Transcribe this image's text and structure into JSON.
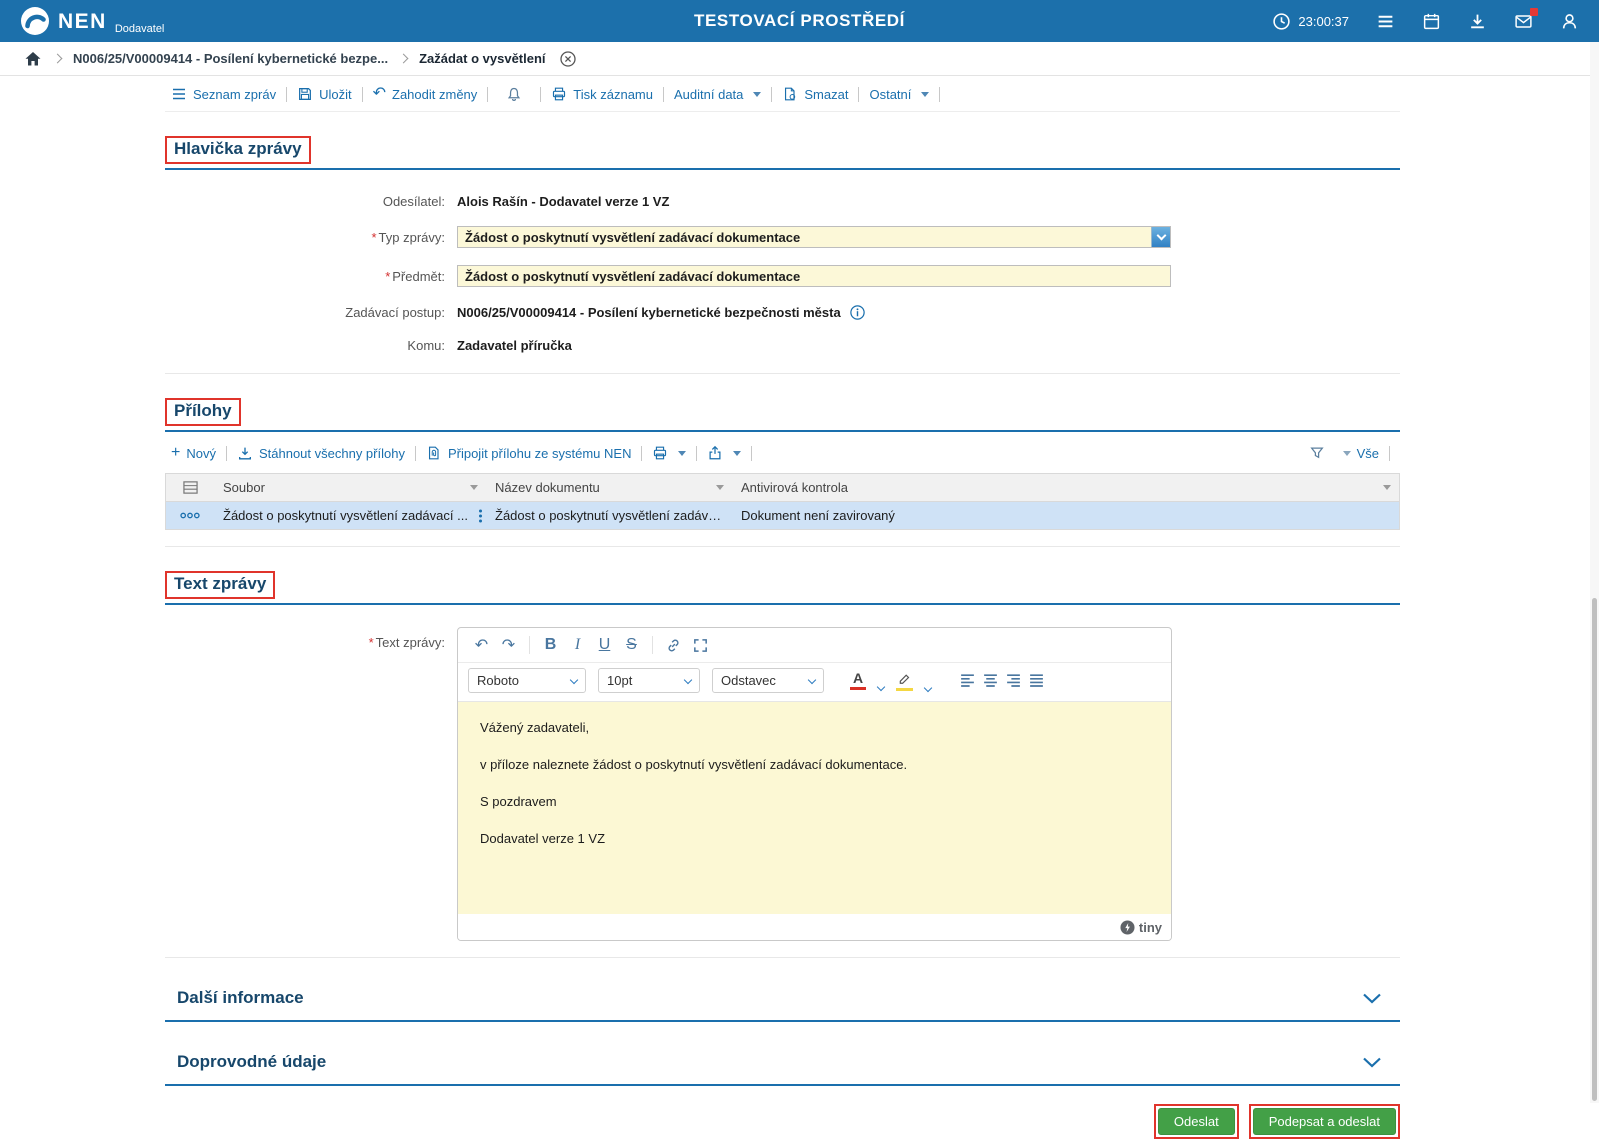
{
  "colors": {
    "header_blue": "#1c70ab",
    "link_blue": "#1a6fad",
    "section_title_blue": "#17476b",
    "field_yellow": "#fcf8d8",
    "selected_row_blue": "#cfe2f6",
    "button_green": "#43a047",
    "annotation_red": "#e0342b"
  },
  "topbar": {
    "brand": "NEN",
    "brand_sub": "Dodavatel",
    "title": "TESTOVACÍ PROSTŘEDÍ",
    "time": "23:00:37"
  },
  "breadcrumb": {
    "procedure": "N006/25/V00009414 - Posílení kybernetické bezpe...",
    "current": "Zažádat o vysvětlení"
  },
  "toolbar": {
    "seznam_zprav": "Seznam zpráv",
    "ulozit": "Uložit",
    "zahodit_zmeny": "Zahodit změny",
    "tisk_zaznamu": "Tisk záznamu",
    "auditni_data": "Auditní data",
    "smazat": "Smazat",
    "ostatni": "Ostatní"
  },
  "hlavicka": {
    "title": "Hlavička zprávy",
    "odesilatel_label": "Odesílatel:",
    "odesilatel_value": "Alois Rašín - Dodavatel verze 1 VZ",
    "typ_label": "Typ zprávy:",
    "typ_value": "Žádost o poskytnutí vysvětlení zadávací dokumentace",
    "predmet_label": "Předmět:",
    "predmet_value": "Žádost o poskytnutí vysvětlení zadávací dokumentace",
    "postup_label": "Zadávací postup:",
    "postup_value": "N006/25/V00009414 - Posílení kybernetické bezpečnosti města",
    "komu_label": "Komu:",
    "komu_value": "Zadavatel příručka"
  },
  "prilohy": {
    "title": "Přílohy",
    "novy": "Nový",
    "plus": "+",
    "stahnout": "Stáhnout všechny přílohy",
    "pripojit": "Připojit přílohu ze systému NEN",
    "vse": "Vše",
    "columns": [
      "Soubor",
      "Název dokumentu",
      "Antivirová kontrola"
    ],
    "row": {
      "soubor": "Žádost o poskytnutí vysvětlení zadávací ...",
      "nazev": "Žádost o poskytnutí vysvětlení zadáva...",
      "antivir": "Dokument není zavirovaný"
    }
  },
  "text_zpravy": {
    "title": "Text zprávy",
    "label": "Text zprávy:",
    "undo": "↶",
    "redo": "↷",
    "bold": "B",
    "italic": "I",
    "underline": "U",
    "strike": "S",
    "font": "Roboto",
    "size": "10pt",
    "block": "Odstavec",
    "color_letter": "A",
    "paragraphs": [
      "Vážený zadavateli,",
      "v příloze naleznete žádost o poskytnutí vysvětlení zadávací dokumentace.",
      "S pozdravem",
      "Dodavatel verze 1 VZ"
    ],
    "tiny": "tiny"
  },
  "collapsed": [
    {
      "title": "Další informace"
    },
    {
      "title": "Doprovodné údaje"
    }
  ],
  "actions": {
    "odeslat": "Odeslat",
    "podepsat_a_odeslat": "Podepsat a odeslat"
  },
  "misc": {
    "required": "*"
  }
}
